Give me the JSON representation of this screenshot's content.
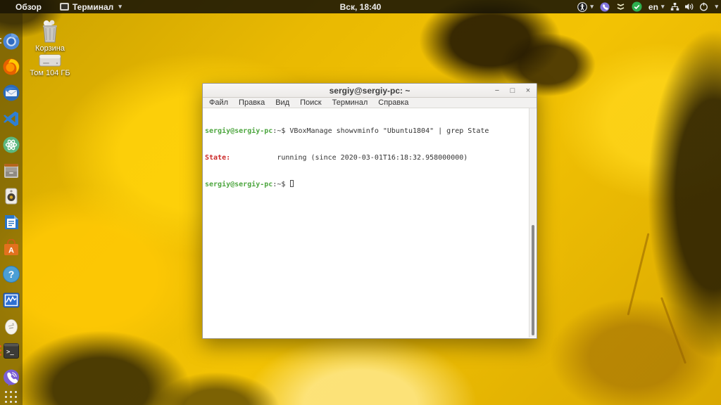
{
  "topbar": {
    "activities_label": "Обзор",
    "focused_app": "Терминал",
    "focused_app_caret": "▾",
    "clock": "Вск, 18:40",
    "keyboard_layout": "en",
    "keyboard_caret": "▾",
    "accessibility_caret": "▾",
    "system_caret": "▾"
  },
  "indicators": [
    "accessibility-icon",
    "viber-indicator-icon",
    "app-zigzag-icon",
    "status-ok-icon",
    "keyboard-layout",
    "network-wired-icon",
    "volume-icon",
    "power-icon"
  ],
  "desktop_icons": [
    {
      "icon": "trash-icon",
      "label": "Корзина"
    },
    {
      "icon": "drive-icon",
      "label": "Том 104 ГБ"
    }
  ],
  "dock": {
    "items": [
      "chromium",
      "firefox",
      "thunderbird",
      "vscode",
      "green-atom-app",
      "file-cabinet",
      "music-player",
      "libreoffice-writer",
      "ubuntu-software",
      "help",
      "system-monitor",
      "egg-app",
      "gimp",
      "terminal",
      "viber"
    ],
    "show_apps": "show-applications"
  },
  "window": {
    "title": "sergiy@sergiy-pc: ~",
    "controls": {
      "minimize": "−",
      "maximize": "□",
      "close": "×"
    },
    "menu": [
      {
        "label": "Файл"
      },
      {
        "label": "Правка"
      },
      {
        "label": "Вид"
      },
      {
        "label": "Поиск"
      },
      {
        "label": "Терминал"
      },
      {
        "label": "Справка"
      }
    ],
    "terminal": {
      "line1": {
        "prompt": "sergiy@sergiy-pc",
        "sep": ":~$",
        "command": " VBoxManage showvminfo \"Ubuntu1804\" | grep State"
      },
      "line2": {
        "state_label": "State:",
        "state_value": "           running (since 2020-03-01T16:18:32.958000000)"
      },
      "line3": {
        "prompt": "sergiy@sergiy-pc",
        "sep": ":~$ "
      }
    }
  },
  "colors": {
    "terminal_prompt_green": "#4da63f",
    "terminal_state_red": "#cc2b2b",
    "topbar_bg": "#181304",
    "status_ok_green": "#2eb050",
    "viber_purple": "#7b5fd6",
    "ubuntu_software_orange": "#e2711d",
    "wallpaper_yellow": "#e9b902"
  }
}
